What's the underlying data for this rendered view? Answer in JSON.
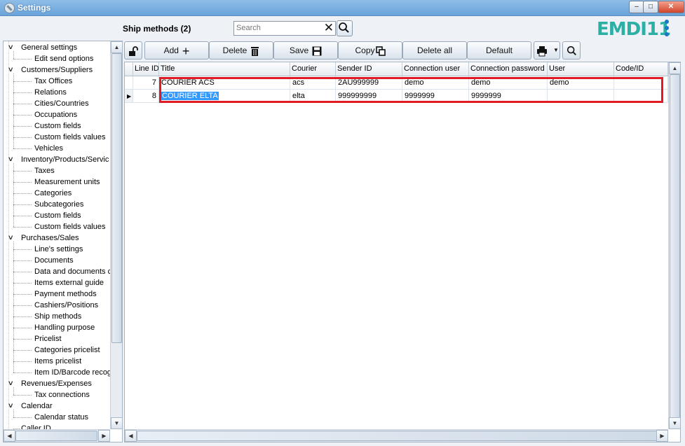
{
  "window": {
    "title": "Settings"
  },
  "header": {
    "section_title": "Ship methods (2)",
    "search_placeholder": "Search",
    "logo": "EMDI11"
  },
  "tree": [
    {
      "label": "General settings",
      "type": "parent"
    },
    {
      "label": "Edit send options",
      "type": "child"
    },
    {
      "label": "Customers/Suppliers",
      "type": "parent"
    },
    {
      "label": "Tax Offices",
      "type": "child"
    },
    {
      "label": "Relations",
      "type": "child"
    },
    {
      "label": "Cities/Countries",
      "type": "child"
    },
    {
      "label": "Occupations",
      "type": "child"
    },
    {
      "label": "Custom fields",
      "type": "child"
    },
    {
      "label": "Custom fields values",
      "type": "child"
    },
    {
      "label": "Vehicles",
      "type": "child"
    },
    {
      "label": "Inventory/Products/Servic",
      "type": "parent"
    },
    {
      "label": "Taxes",
      "type": "child"
    },
    {
      "label": "Measurement units",
      "type": "child"
    },
    {
      "label": "Categories",
      "type": "child"
    },
    {
      "label": "Subcategories",
      "type": "child"
    },
    {
      "label": "Custom fields",
      "type": "child"
    },
    {
      "label": "Custom fields values",
      "type": "child"
    },
    {
      "label": "Purchases/Sales",
      "type": "parent"
    },
    {
      "label": "Line's settings",
      "type": "child"
    },
    {
      "label": "Documents",
      "type": "child"
    },
    {
      "label": "Data and documents c",
      "type": "child"
    },
    {
      "label": "Items external guide",
      "type": "child"
    },
    {
      "label": "Payment methods",
      "type": "child"
    },
    {
      "label": "Cashiers/Positions",
      "type": "child"
    },
    {
      "label": "Ship methods",
      "type": "child"
    },
    {
      "label": "Handling purpose",
      "type": "child"
    },
    {
      "label": "Pricelist",
      "type": "child"
    },
    {
      "label": "Categories pricelist",
      "type": "child"
    },
    {
      "label": "Items pricelist",
      "type": "child"
    },
    {
      "label": "Item ID/Barcode recog",
      "type": "child"
    },
    {
      "label": "Revenues/Expenses",
      "type": "parent"
    },
    {
      "label": "Tax connections",
      "type": "child"
    },
    {
      "label": "Calendar",
      "type": "parent"
    },
    {
      "label": "Calendar status",
      "type": "child"
    },
    {
      "label": "Caller ID",
      "type": "leaf-root"
    }
  ],
  "toolbar": {
    "add": "Add",
    "delete": "Delete",
    "save": "Save",
    "copy": "Copy",
    "delete_all": "Delete all",
    "default": "Default"
  },
  "grid": {
    "columns": [
      "Line ID",
      "Title",
      "Courier",
      "Sender ID",
      "Connection user",
      "Connection password",
      "User",
      "Code/ID"
    ],
    "rows": [
      [
        "7",
        "COURIER ACS",
        "acs",
        "2AU999999",
        "demo",
        "demo",
        "demo",
        ""
      ],
      [
        "8",
        "COURIER ELTA",
        "elta",
        "999999999",
        "9999999",
        "9999999",
        "",
        ""
      ]
    ],
    "current_row": 1
  },
  "colors": {
    "titlebar": "#6aa3d9",
    "selection": "#3399ff",
    "highlight_box": "#e01b24",
    "logo": "#2ab0a5"
  }
}
